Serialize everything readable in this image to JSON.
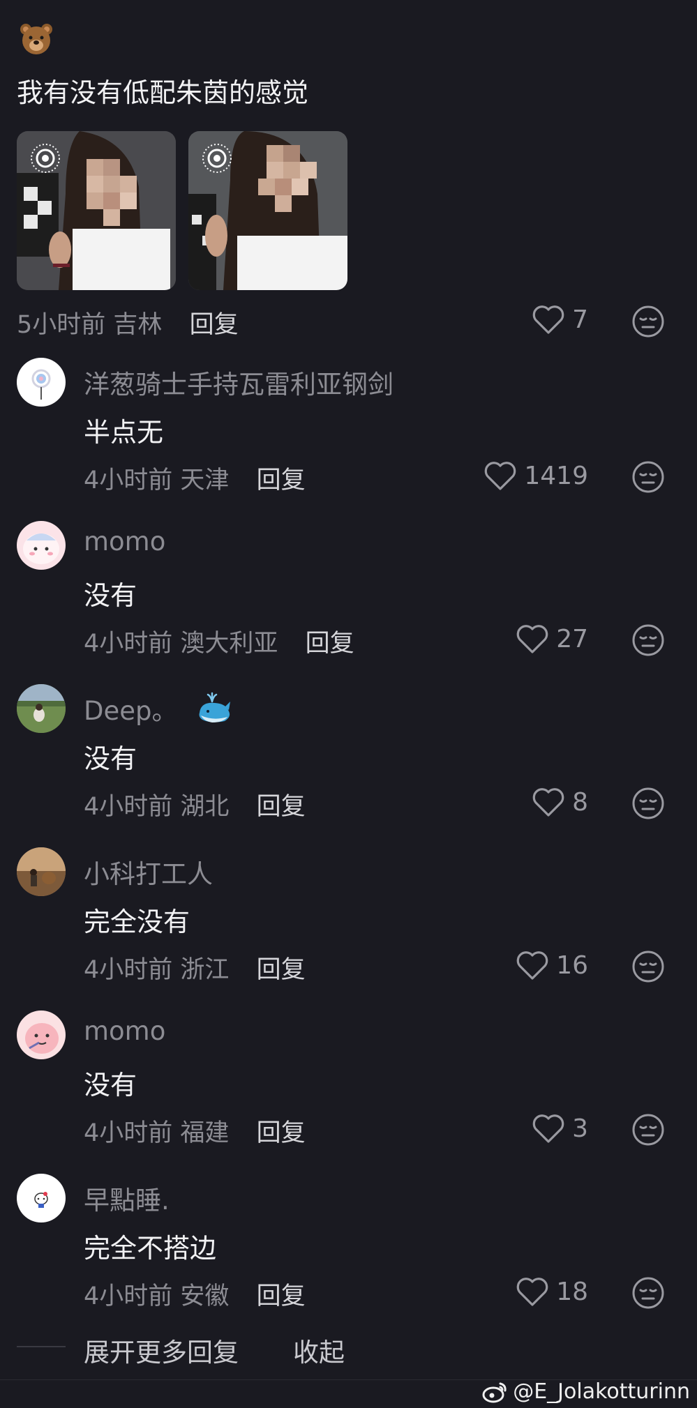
{
  "post": {
    "text": "我有没有低配朱茵的感觉",
    "time": "5小时前",
    "location": "吉林",
    "reply_label": "回复",
    "likes": "7",
    "images": [
      {
        "icon": "live-photo-icon"
      },
      {
        "icon": "live-photo-icon"
      }
    ]
  },
  "comments": [
    {
      "username": "洋葱骑士手持瓦雷利亚钢剑",
      "text": "半点无",
      "time": "4小时前",
      "location": "天津",
      "reply_label": "回复",
      "likes": "1419"
    },
    {
      "username": "momo",
      "text": "没有",
      "time": "4小时前",
      "location": "澳大利亚",
      "reply_label": "回复",
      "likes": "27"
    },
    {
      "username": "Deep。",
      "text": "没有",
      "time": "4小时前",
      "location": "湖北",
      "reply_label": "回复",
      "likes": "8"
    },
    {
      "username": "小科打工人",
      "text": "完全没有",
      "time": "4小时前",
      "location": "浙江",
      "reply_label": "回复",
      "likes": "16"
    },
    {
      "username": "momo",
      "text": "没有",
      "time": "4小时前",
      "location": "福建",
      "reply_label": "回复",
      "likes": "3"
    },
    {
      "username": "早點睡.",
      "text": "完全不搭边",
      "time": "4小时前",
      "location": "安徽",
      "reply_label": "回复",
      "likes": "18"
    }
  ],
  "footer": {
    "expand_label": "展开更多回复",
    "collapse_label": "收起"
  },
  "watermark": "@E_Jolakotturinn",
  "colors": {
    "background": "#1a1a21",
    "primary_text": "#f2f2f4",
    "secondary_text": "#8c8c93"
  }
}
